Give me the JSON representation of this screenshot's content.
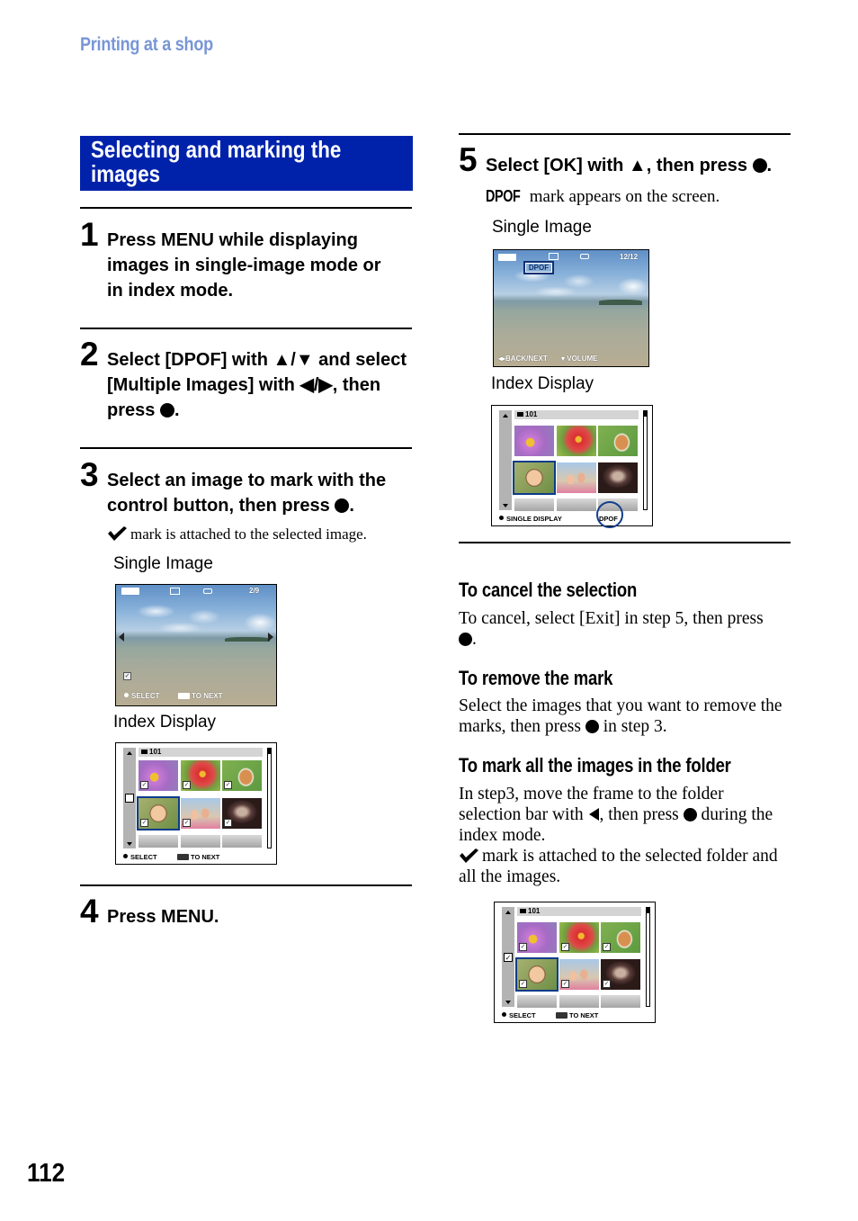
{
  "header": {
    "section_label": "Printing at a shop"
  },
  "title": "Selecting and marking the images",
  "steps": [
    {
      "num": "1",
      "lines": [
        "Press MENU while displaying",
        "images in single-image mode or",
        "in index mode."
      ]
    },
    {
      "num": "2",
      "lines": [
        "Select [DPOF] with ▲/▼ and select",
        "[Multiple Images] with ◀/▶, then",
        "press"
      ]
    },
    {
      "num": "3",
      "lines": [
        "Select an image to mark with the",
        "control button, then press"
      ],
      "note": "mark is attached to the selected image.",
      "single_caption": "Single Image",
      "index_caption": "Index Display"
    },
    {
      "num": "4",
      "lines": [
        "Press MENU."
      ]
    },
    {
      "num": "5",
      "lines": [
        "Select [OK] with ▲, then press"
      ],
      "note_prefix": "DPOF",
      "note": "mark appears on the screen.",
      "single_caption": "Single Image",
      "index_caption": "Index Display"
    }
  ],
  "screens": {
    "step3_single": {
      "counter": "2/9",
      "footer_select": "SELECT",
      "footer_next": "TO NEXT"
    },
    "step3_index": {
      "folder": "101",
      "footer_select": "SELECT",
      "footer_next": "TO NEXT"
    },
    "step5_single": {
      "counter": "12/12",
      "dpof_badge": "DPOF",
      "footer_back": "BACK/NEXT",
      "footer_volume": "VOLUME"
    },
    "step5_index": {
      "folder": "101",
      "footer_select": "SINGLE DISPLAY",
      "footer_dpof": "DPOF"
    },
    "folder_index": {
      "folder": "101",
      "footer_select": "SELECT",
      "footer_next": "TO NEXT"
    }
  },
  "tips": [
    {
      "heading": "To cancel the selection",
      "text_a": "To cancel, select [Exit] in step 5, then press",
      "text_b": "."
    },
    {
      "heading": "To remove the mark",
      "text_a": "Select the images that you want to remove the marks, then press",
      "text_b": "in step 3."
    },
    {
      "heading": "To mark all the images in the folder",
      "text_a": "In step3, move the frame to the folder selection bar with",
      "text_b": ", then press",
      "text_c": "during the index mode.",
      "text_d": "mark is attached to the selected folder and all the images."
    }
  ],
  "page_number": "112"
}
